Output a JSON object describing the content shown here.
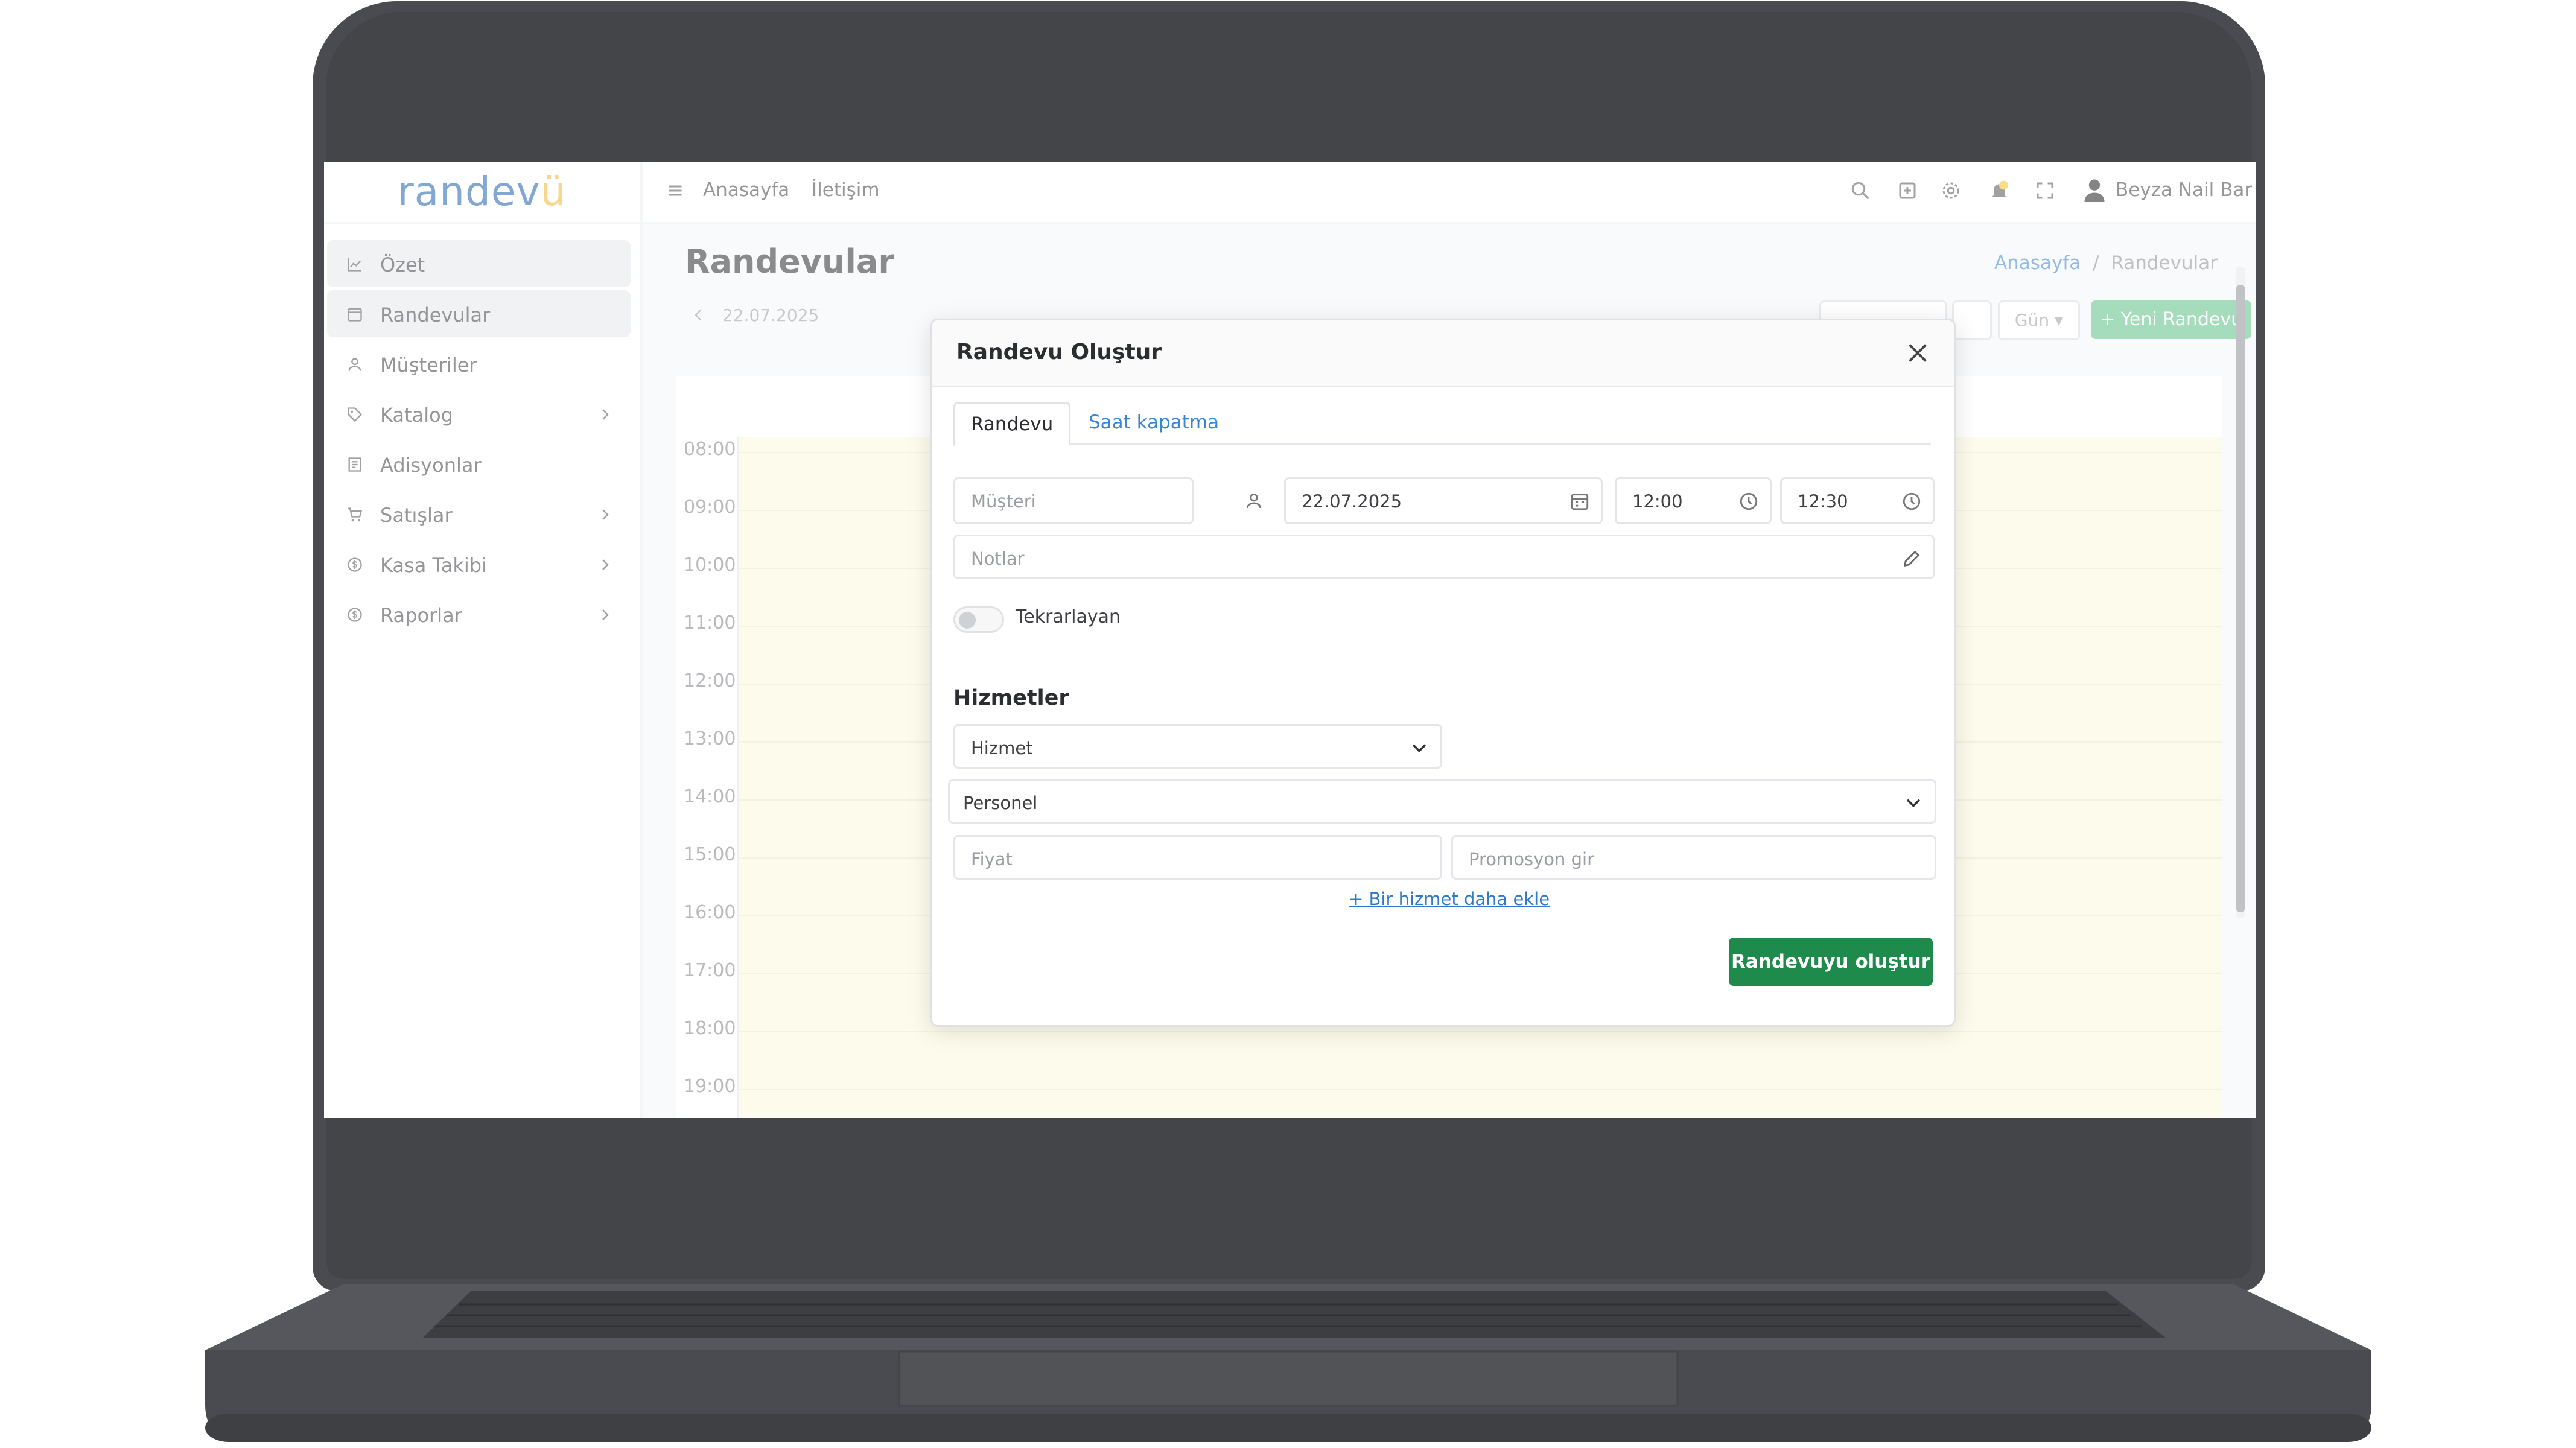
{
  "app": {
    "logo_main": "randev",
    "logo_accent": "ü"
  },
  "sidebar": {
    "items": [
      {
        "label": "Özet",
        "icon": "chart-line-icon"
      },
      {
        "label": "Randevular",
        "icon": "calendar-icon"
      },
      {
        "label": "Müşteriler",
        "icon": "user-icon"
      },
      {
        "label": "Katalog",
        "icon": "tag-icon"
      },
      {
        "label": "Adisyonlar",
        "icon": "receipt-icon"
      },
      {
        "label": "Satışlar",
        "icon": "cart-icon"
      },
      {
        "label": "Kasa Takibi",
        "icon": "coin-icon"
      },
      {
        "label": "Raporlar",
        "icon": "coin-icon"
      }
    ]
  },
  "topbar": {
    "links": [
      "Anasayfa",
      "İletişim"
    ],
    "user_name": "Beyza Nail Bar"
  },
  "page": {
    "title": "Randevular",
    "breadcrumb": {
      "home": "Anasayfa",
      "separator": "/",
      "current": "Randevular"
    }
  },
  "toolbar": {
    "date": "22.07.2025",
    "view_label": "Gün",
    "new_button": "+ Yeni Randevu"
  },
  "calendar": {
    "hours": [
      "08:00",
      "09:00",
      "10:00",
      "11:00",
      "12:00",
      "13:00",
      "14:00",
      "15:00",
      "16:00",
      "17:00",
      "18:00",
      "19:00"
    ]
  },
  "modal": {
    "title": "Randevu Oluştur",
    "tabs": [
      "Randevu",
      "Saat kapatma"
    ],
    "customer_placeholder": "Müşteri",
    "date_value": "22.07.2025",
    "start_time": "12:00",
    "end_time": "12:30",
    "notes_placeholder": "Notlar",
    "recurring_label": "Tekrarlayan",
    "recurring_on": false,
    "services_title": "Hizmetler",
    "service_select": "Hizmet",
    "staff_select": "Personel",
    "price_placeholder": "Fiyat",
    "promo_placeholder": "Promosyon gir",
    "add_service_link": "+ Bir hizmet daha ekle",
    "submit_label": "Randevuyu oluştur"
  },
  "colors": {
    "brand_blue": "#1d5fae",
    "brand_accent": "#f1b531",
    "link_blue": "#3a86d4",
    "success_green": "#1e8a4c",
    "new_button_green": "#5cbf84",
    "calendar_bg": "#fcf7dc",
    "notification_yellow": "#f4c324"
  }
}
